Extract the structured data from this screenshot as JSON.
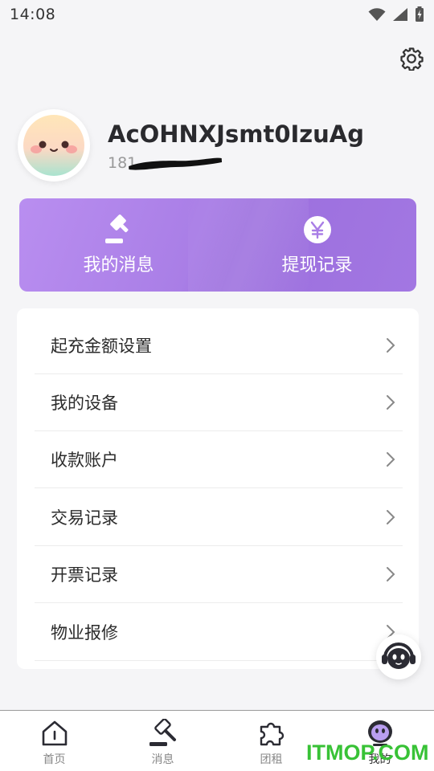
{
  "status_bar": {
    "time": "14:08",
    "icons": [
      "wifi-icon",
      "cellular-signal-icon",
      "battery-charging-icon"
    ]
  },
  "header": {
    "settings_icon": "gear-icon"
  },
  "profile": {
    "username": "AcOHNXJsmt0IzuAg",
    "phone": "181"
  },
  "actions": [
    {
      "label": "我的消息",
      "icon": "gavel-icon"
    },
    {
      "label": "提现记录",
      "icon": "yuan-coin-icon"
    }
  ],
  "menu": {
    "items": [
      {
        "label": "起充金额设置"
      },
      {
        "label": "我的设备"
      },
      {
        "label": "收款账户"
      },
      {
        "label": "交易记录"
      },
      {
        "label": "开票记录"
      },
      {
        "label": "物业报修"
      }
    ]
  },
  "support": {
    "icon": "customer-service-icon"
  },
  "tabs": [
    {
      "label": "首页",
      "icon": "home-icon"
    },
    {
      "label": "消息",
      "icon": "gavel-icon"
    },
    {
      "label": "团租",
      "icon": "puzzle-icon"
    },
    {
      "label": "我的",
      "icon": "mascot-face-icon",
      "active": true
    }
  ],
  "watermark": {
    "text": "ITMOP.COM"
  },
  "colors": {
    "accent_purple": "#a97ee6",
    "watermark_green": "#38c236",
    "background": "#f5f5f7"
  }
}
